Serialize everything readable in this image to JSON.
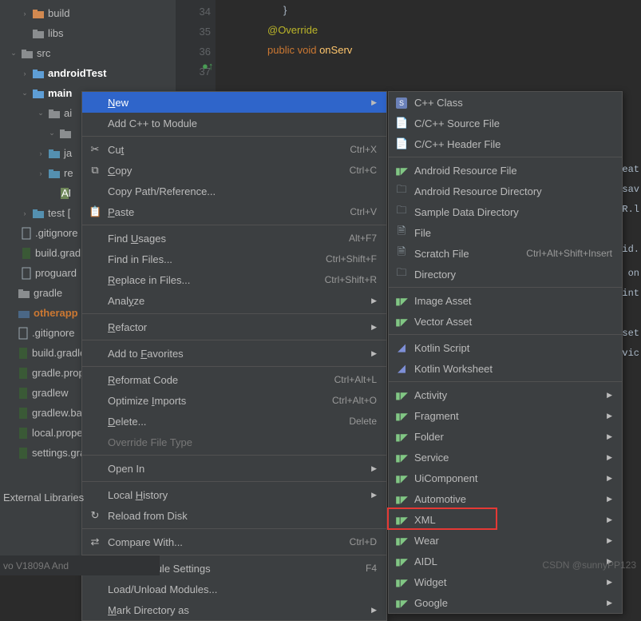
{
  "tree": {
    "items": [
      {
        "indent": 18,
        "arrow": "›",
        "icon": "folder-open",
        "label": "build",
        "cls": ""
      },
      {
        "indent": 18,
        "arrow": "",
        "icon": "folder",
        "label": "libs",
        "cls": ""
      },
      {
        "indent": 4,
        "arrow": "⌄",
        "icon": "folder",
        "label": "src",
        "cls": ""
      },
      {
        "indent": 18,
        "arrow": "›",
        "icon": "pkg-src",
        "label": "androidTest",
        "cls": "label-bold"
      },
      {
        "indent": 18,
        "arrow": "⌄",
        "icon": "pkg-src",
        "label": "main",
        "cls": "label-bold"
      },
      {
        "indent": 38,
        "arrow": "⌄",
        "icon": "folder",
        "label": "ai",
        "cls": ""
      },
      {
        "indent": 52,
        "arrow": "⌄",
        "icon": "folder",
        "label": "",
        "cls": ""
      },
      {
        "indent": 38,
        "arrow": "›",
        "icon": "pkg",
        "label": "ja",
        "cls": ""
      },
      {
        "indent": 38,
        "arrow": "›",
        "icon": "pkg",
        "label": "re",
        "cls": ""
      },
      {
        "indent": 52,
        "arrow": "",
        "icon": "file-xml",
        "label": "",
        "cls": ""
      },
      {
        "indent": 18,
        "arrow": "›",
        "icon": "pkg",
        "label": "test [",
        "cls": ""
      },
      {
        "indent": 4,
        "arrow": "",
        "icon": "file",
        "label": ".gitignore",
        "cls": ""
      },
      {
        "indent": 4,
        "arrow": "",
        "icon": "file-grad",
        "label": "build.grad",
        "cls": ""
      },
      {
        "indent": 4,
        "arrow": "",
        "icon": "file",
        "label": "proguard",
        "cls": ""
      },
      {
        "indent": 0,
        "arrow": "",
        "icon": "folder",
        "label": "gradle",
        "cls": ""
      },
      {
        "indent": 0,
        "arrow": "",
        "icon": "module",
        "label": "otherapp",
        "cls": "label-orange"
      },
      {
        "indent": 0,
        "arrow": "",
        "icon": "file",
        "label": ".gitignore",
        "cls": ""
      },
      {
        "indent": 0,
        "arrow": "",
        "icon": "file-grad",
        "label": "build.gradle",
        "cls": ""
      },
      {
        "indent": 0,
        "arrow": "",
        "icon": "file-grad",
        "label": "gradle.prope",
        "cls": ""
      },
      {
        "indent": 0,
        "arrow": "",
        "icon": "file-grad",
        "label": "gradlew",
        "cls": ""
      },
      {
        "indent": 0,
        "arrow": "",
        "icon": "file-grad",
        "label": "gradlew.bat",
        "cls": ""
      },
      {
        "indent": 0,
        "arrow": "",
        "icon": "file-grad",
        "label": "local.prope",
        "cls": ""
      },
      {
        "indent": 0,
        "arrow": "",
        "icon": "file-grad",
        "label": "settings.gra",
        "cls": ""
      }
    ],
    "external": "External Libraries"
  },
  "editor": {
    "lines": [
      "",
      "34",
      "35",
      "36",
      "37"
    ],
    "code_brace": "}",
    "code_ann": "@Override",
    "code_line3a": "public",
    "code_line3b": "void",
    "code_line3c": "onServ"
  },
  "menu1": [
    {
      "type": "item",
      "icon": "",
      "label": "New",
      "u": 0,
      "shortcut": "",
      "sub": true,
      "sel": true
    },
    {
      "type": "item",
      "icon": "",
      "label": "Add C++ to Module",
      "shortcut": ""
    },
    {
      "type": "sep"
    },
    {
      "type": "item",
      "icon": "cut",
      "label": "Cut",
      "u": 2,
      "shortcut": "Ctrl+X"
    },
    {
      "type": "item",
      "icon": "copy",
      "label": "Copy",
      "u": 0,
      "shortcut": "Ctrl+C"
    },
    {
      "type": "item",
      "icon": "",
      "label": "Copy Path/Reference..."
    },
    {
      "type": "item",
      "icon": "paste",
      "label": "Paste",
      "u": 0,
      "shortcut": "Ctrl+V"
    },
    {
      "type": "sep"
    },
    {
      "type": "item",
      "icon": "",
      "label": "Find Usages",
      "u": 5,
      "shortcut": "Alt+F7"
    },
    {
      "type": "item",
      "icon": "",
      "label": "Find in Files...",
      "shortcut": "Ctrl+Shift+F"
    },
    {
      "type": "item",
      "icon": "",
      "label": "Replace in Files...",
      "u": 0,
      "shortcut": "Ctrl+Shift+R"
    },
    {
      "type": "item",
      "icon": "",
      "label": "Analyze",
      "u": 4,
      "sub": true
    },
    {
      "type": "sep"
    },
    {
      "type": "item",
      "icon": "",
      "label": "Refactor",
      "u": 0,
      "sub": true
    },
    {
      "type": "sep"
    },
    {
      "type": "item",
      "icon": "",
      "label": "Add to Favorites",
      "u": 7,
      "sub": true
    },
    {
      "type": "sep"
    },
    {
      "type": "item",
      "icon": "",
      "label": "Reformat Code",
      "u": 0,
      "shortcut": "Ctrl+Alt+L"
    },
    {
      "type": "item",
      "icon": "",
      "label": "Optimize Imports",
      "u": 9,
      "shortcut": "Ctrl+Alt+O"
    },
    {
      "type": "item",
      "icon": "",
      "label": "Delete...",
      "u": 0,
      "shortcut": "Delete"
    },
    {
      "type": "item",
      "icon": "",
      "label": "Override File Type",
      "disabled": true
    },
    {
      "type": "sep"
    },
    {
      "type": "item",
      "icon": "",
      "label": "Open In",
      "sub": true
    },
    {
      "type": "sep"
    },
    {
      "type": "item",
      "icon": "",
      "label": "Local History",
      "u": 6,
      "sub": true
    },
    {
      "type": "item",
      "icon": "reload",
      "label": "Reload from Disk"
    },
    {
      "type": "sep"
    },
    {
      "type": "item",
      "icon": "compare",
      "label": "Compare With...",
      "shortcut": "Ctrl+D"
    },
    {
      "type": "sep"
    },
    {
      "type": "item",
      "icon": "",
      "label": "Open Module Settings",
      "shortcut": "F4"
    },
    {
      "type": "item",
      "icon": "",
      "label": "Load/Unload Modules..."
    },
    {
      "type": "item",
      "icon": "",
      "label": "Mark Directory as",
      "u": 0,
      "sub": true
    }
  ],
  "menu2": [
    {
      "icon": "s",
      "label": "C++ Class"
    },
    {
      "icon": "cfile",
      "label": "C/C++ Source File"
    },
    {
      "icon": "hfile",
      "label": "C/C++ Header File"
    },
    {
      "type": "sep"
    },
    {
      "icon": "and",
      "label": "Android Resource File"
    },
    {
      "icon": "folder",
      "label": "Android Resource Directory"
    },
    {
      "icon": "folder",
      "label": "Sample Data Directory"
    },
    {
      "icon": "file",
      "label": "File"
    },
    {
      "icon": "file",
      "label": "Scratch File",
      "shortcut": "Ctrl+Alt+Shift+Insert"
    },
    {
      "icon": "folder",
      "label": "Directory"
    },
    {
      "type": "sep"
    },
    {
      "icon": "and",
      "label": "Image Asset"
    },
    {
      "icon": "and",
      "label": "Vector Asset"
    },
    {
      "type": "sep"
    },
    {
      "icon": "kt",
      "label": "Kotlin Script"
    },
    {
      "icon": "kt",
      "label": "Kotlin Worksheet"
    },
    {
      "type": "sep"
    },
    {
      "icon": "and",
      "label": "Activity",
      "sub": true
    },
    {
      "icon": "and",
      "label": "Fragment",
      "sub": true
    },
    {
      "icon": "and",
      "label": "Folder",
      "sub": true
    },
    {
      "icon": "and",
      "label": "Service",
      "sub": true
    },
    {
      "icon": "and",
      "label": "UiComponent",
      "sub": true
    },
    {
      "icon": "and",
      "label": "Automotive",
      "sub": true
    },
    {
      "icon": "and",
      "label": "XML",
      "sub": true,
      "hl": true
    },
    {
      "icon": "and",
      "label": "Wear",
      "sub": true
    },
    {
      "icon": "and",
      "label": "AIDL",
      "sub": true
    },
    {
      "icon": "and",
      "label": "Widget",
      "sub": true
    },
    {
      "icon": "and",
      "label": "Google",
      "sub": true
    }
  ],
  "bottom": "vo V1809A And",
  "watermark": "CSDN @sunnyPP123",
  "codefrags": [
    "eat",
    "sav",
    "R.l",
    "id.",
    "on",
    "int",
    "set",
    "vic"
  ]
}
